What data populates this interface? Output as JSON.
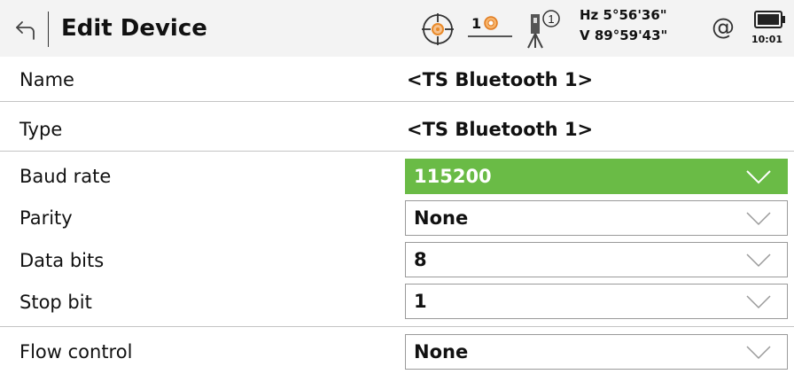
{
  "header": {
    "title": "Edit Device",
    "prism_count": "1",
    "hz_angle": "Hz 5°56'36\"",
    "v_angle": "V  89°59'43\"",
    "at_symbol": "@",
    "time": "10:01",
    "instrument_number": "1"
  },
  "fields": {
    "name": {
      "label": "Name",
      "value": "<TS Bluetooth 1>"
    },
    "type": {
      "label": "Type",
      "value": "<TS Bluetooth 1>"
    },
    "baud_rate": {
      "label": "Baud rate",
      "value": "115200"
    },
    "parity": {
      "label": "Parity",
      "value": "None"
    },
    "data_bits": {
      "label": "Data bits",
      "value": "8"
    },
    "stop_bit": {
      "label": "Stop bit",
      "value": "1"
    },
    "flow_control": {
      "label": "Flow control",
      "value": "None"
    }
  },
  "colors": {
    "accent_green": "#6abb46",
    "header_bg": "#f3f3f3",
    "prism_orange": "#f28c28"
  },
  "icons": [
    "back-icon",
    "target-icon",
    "prism-icon",
    "instrument-icon",
    "at-icon",
    "battery-icon",
    "chevron-down-icon"
  ]
}
